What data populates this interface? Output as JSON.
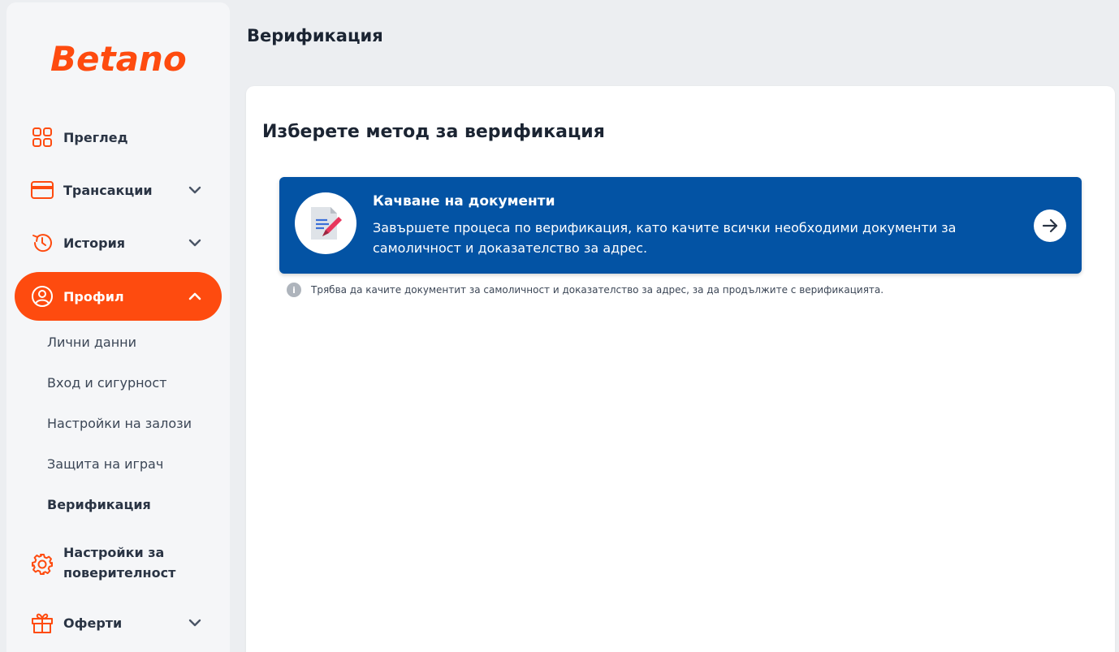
{
  "brand": {
    "name": "Betano",
    "color": "#fe4b0f"
  },
  "page_title": "Верификация",
  "sidebar": {
    "nav": [
      {
        "label": "Преглед",
        "icon": "grid-icon",
        "expandable": false
      },
      {
        "label": "Трансакции",
        "icon": "credit-card-icon",
        "expandable": true
      },
      {
        "label": "История",
        "icon": "history-icon",
        "expandable": true
      },
      {
        "label": "Профил",
        "icon": "user-circle-icon",
        "expandable": true,
        "expanded": true,
        "active": true
      },
      {
        "label": "Настройки за поверителност",
        "icon": "gear-icon",
        "expandable": false
      },
      {
        "label": "Оферти",
        "icon": "gift-icon",
        "expandable": true
      }
    ],
    "sub_items": [
      {
        "label": "Лични данни"
      },
      {
        "label": "Вход и сигурност"
      },
      {
        "label": "Настройки на залози"
      },
      {
        "label": "Защита на играч"
      },
      {
        "label": "Верификация",
        "current": true
      }
    ]
  },
  "main": {
    "heading": "Изберете метод за верификация",
    "method_card": {
      "title": "Качване на документи",
      "description": "Завършете процеса по верификация, като качите всички необходими документи за самоличност и доказателство за адрес.",
      "icon": "document-pen-icon",
      "action_icon": "arrow-right-icon",
      "bg_color": "#0353a4"
    },
    "info_note": "Трябва да качите документит за самоличност и доказателство за адрес, за да продължите с верификацията."
  }
}
